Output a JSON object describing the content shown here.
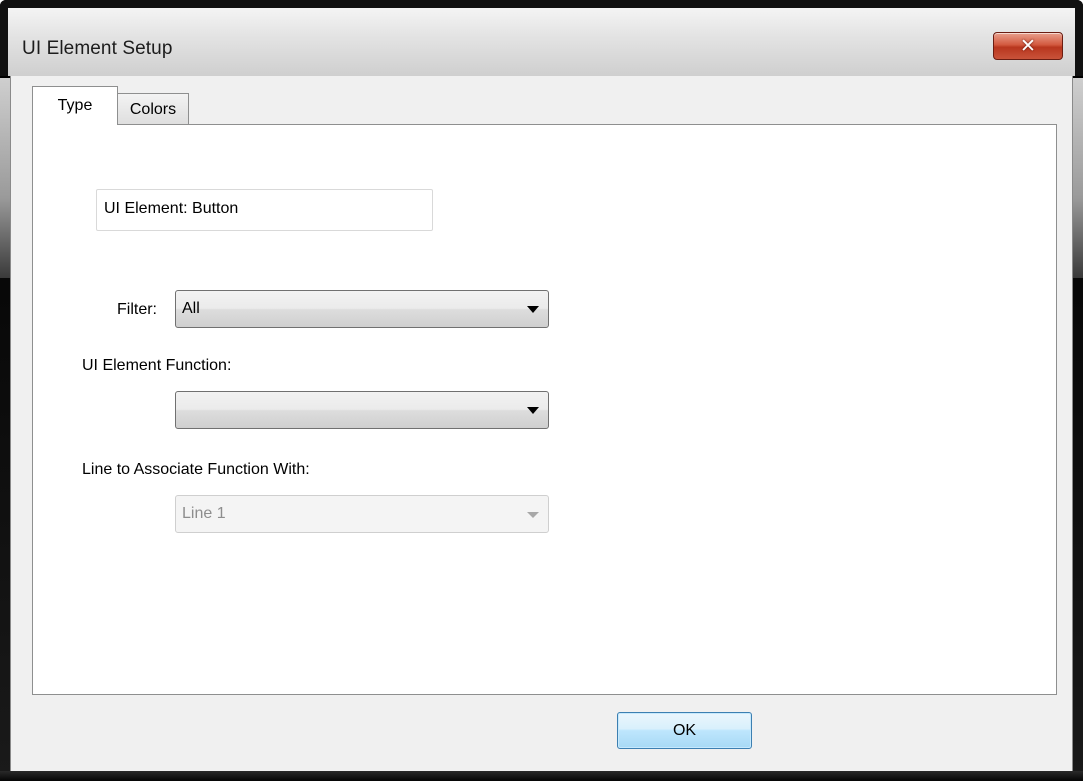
{
  "window": {
    "title": "UI Element Setup",
    "close_glyph": "✕"
  },
  "tabs": [
    {
      "label": "Type",
      "selected": true
    },
    {
      "label": "Colors",
      "selected": false
    }
  ],
  "form": {
    "element_name": "UI Element: Button",
    "filter_label": "Filter:",
    "filter_value": "All",
    "function_label": "UI Element Function:",
    "function_value": "",
    "line_label": "Line to Associate Function With:",
    "line_value": "Line 1",
    "line_enabled": false
  },
  "buttons": {
    "ok_label": "OK"
  },
  "icons": {
    "close": "close-icon",
    "dropdown": "chevron-down-icon"
  },
  "colors": {
    "close_button": "#c9533a",
    "ok_button_border": "#3c7fb1",
    "panel_background": "#ffffff",
    "dialog_background": "#f0f0f0"
  }
}
